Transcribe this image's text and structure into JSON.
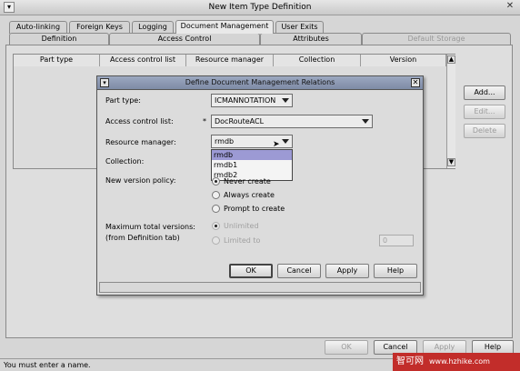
{
  "window": {
    "title": "New Item Type Definition"
  },
  "tabs_top": [
    {
      "label": "Auto-linking"
    },
    {
      "label": "Foreign Keys"
    },
    {
      "label": "Logging"
    },
    {
      "label": "Document Management"
    },
    {
      "label": "User Exits"
    }
  ],
  "tabs_bottom": [
    {
      "label": "Definition"
    },
    {
      "label": "Access Control"
    },
    {
      "label": "Attributes"
    },
    {
      "label": "Default Storage"
    }
  ],
  "table": {
    "columns": [
      "Part type",
      "Access control list",
      "Resource manager",
      "Collection",
      "Version"
    ]
  },
  "side_buttons": {
    "add": "Add...",
    "edit": "Edit...",
    "delete": "Delete"
  },
  "bottom_buttons": {
    "ok": "OK",
    "cancel": "Cancel",
    "apply": "Apply",
    "help": "Help"
  },
  "status": {
    "message": "You must enter a name."
  },
  "watermark": {
    "text": "智可网",
    "url": "www.hzhike.com"
  },
  "dialog": {
    "title": "Define Document Management Relations",
    "part_type": {
      "label": "Part type:",
      "value": "ICMANNOTATION"
    },
    "acl": {
      "label": "Access control list:",
      "required_mark": "*",
      "value": "DocRouteACL"
    },
    "resource_manager": {
      "label": "Resource manager:",
      "value": "rmdb",
      "options": [
        "rmdb",
        "rmdb1",
        "rmdb2"
      ],
      "selected_index": 0
    },
    "collection": {
      "label": "Collection:"
    },
    "version_policy": {
      "label": "New version policy:",
      "options": [
        "Never create",
        "Always create",
        "Prompt to create"
      ],
      "selected_index": 0
    },
    "max_versions": {
      "label_line1": "Maximum total versions:",
      "label_line2": "(from Definition tab)",
      "unlimited": "Unlimited",
      "limited_to": "Limited to",
      "limited_value": "0"
    },
    "buttons": {
      "ok": "OK",
      "cancel": "Cancel",
      "apply": "Apply",
      "help": "Help"
    }
  }
}
